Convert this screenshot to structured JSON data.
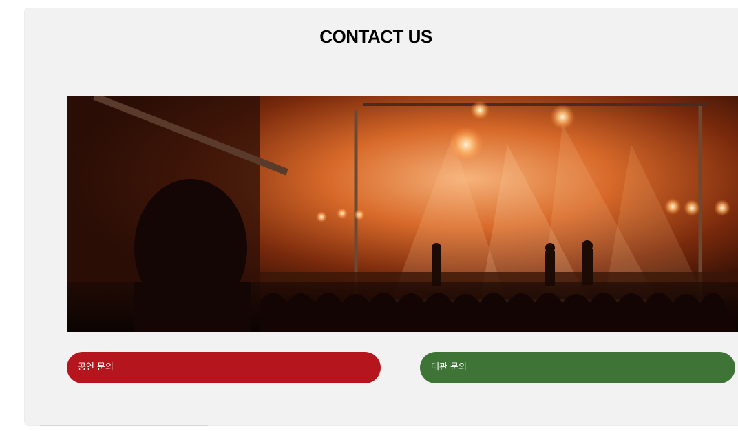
{
  "section": {
    "title": "CONTACT US"
  },
  "hero_image": {
    "subject": "concert-stage-photo"
  },
  "buttons": {
    "performance_inquiry": "공연 문의",
    "rental_inquiry": "대관 문의"
  },
  "colors": {
    "card_background": "#f2f2f2",
    "button_red": "#b5151d",
    "button_green": "#3e7436",
    "title_text": "#000000"
  }
}
